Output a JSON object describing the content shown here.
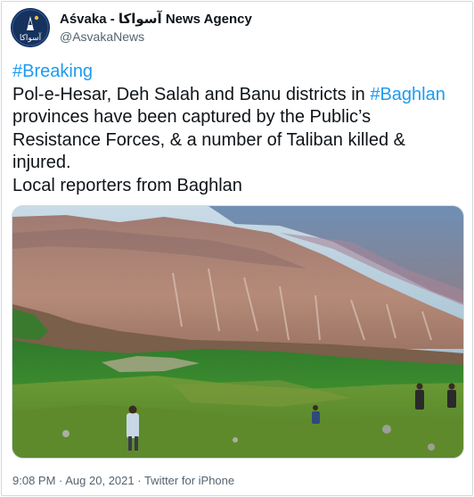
{
  "account": {
    "display_name": "Aśvaka - آسواکا News Agency",
    "handle": "@AsvakaNews",
    "avatar_text": "آسواکا"
  },
  "tweet": {
    "hashtag_breaking": "#Breaking",
    "line2_prefix": "Pol-e-Hesar, Deh Salah and Banu districts in ",
    "hashtag_region": "#Baghlan",
    "line3": "provinces have been captured by the Public’s",
    "line4": "Resistance Forces, & a number of Taliban killed &",
    "line5": "injured.",
    "line6": "Local reporters from Baghlan"
  },
  "meta": {
    "time": "9:08 PM",
    "separator": " · ",
    "date": "Aug 20, 2021",
    "source": "Twitter for iPhone"
  },
  "colors": {
    "link": "#1d9bf0",
    "text": "#0f1419",
    "secondary": "#536471",
    "border": "#cfd9de",
    "avatar_bg": "#16325e"
  }
}
